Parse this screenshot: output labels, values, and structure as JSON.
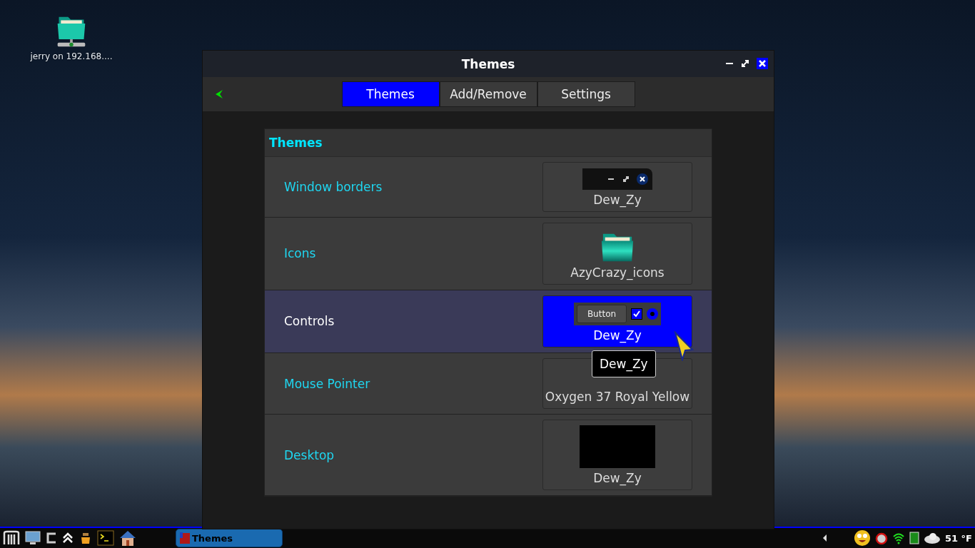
{
  "desktop_icons": [
    {
      "label": "jerry on 192.168...."
    }
  ],
  "window": {
    "title": "Themes"
  },
  "tabs": [
    {
      "label": "Themes",
      "selected": true
    },
    {
      "label": "Add/Remove",
      "selected": false
    },
    {
      "label": "Settings",
      "selected": false
    }
  ],
  "themes_panel": {
    "title": "Themes",
    "rows": [
      {
        "kind": "window_borders",
        "label": "Window borders",
        "value": "Dew_Zy",
        "selected": false
      },
      {
        "kind": "icons",
        "label": "Icons",
        "value": "AzyCrazy_icons",
        "selected": false
      },
      {
        "kind": "controls",
        "label": "Controls",
        "value": "Dew_Zy",
        "selected": true,
        "preview": {
          "button": "Button",
          "checked": true,
          "radio_selected": true
        }
      },
      {
        "kind": "mouse_pointer",
        "label": "Mouse Pointer",
        "value": "Oxygen 37 Royal Yellow",
        "selected": false
      },
      {
        "kind": "desktop",
        "label": "Desktop",
        "value": "Dew_Zy",
        "selected": false
      }
    ]
  },
  "tooltip": "Dew_Zy",
  "taskbar": {
    "tasks": [
      {
        "label": "Themes",
        "selected": true
      }
    ],
    "weather": "51 °F"
  }
}
